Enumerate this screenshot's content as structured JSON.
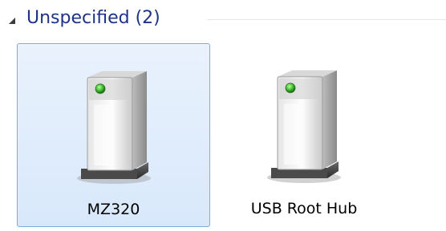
{
  "group": {
    "title": "Unspecified (2)",
    "expanded": true
  },
  "devices": [
    {
      "label": "MZ320",
      "selected": true,
      "icon": "generic-device-icon"
    },
    {
      "label": "USB Root Hub",
      "selected": false,
      "icon": "generic-device-icon"
    }
  ],
  "colors": {
    "group_title": "#1e3287",
    "selection_border": "#84acdd",
    "selection_fill": "#dde9fb",
    "status_light": "#3fbf2f"
  }
}
